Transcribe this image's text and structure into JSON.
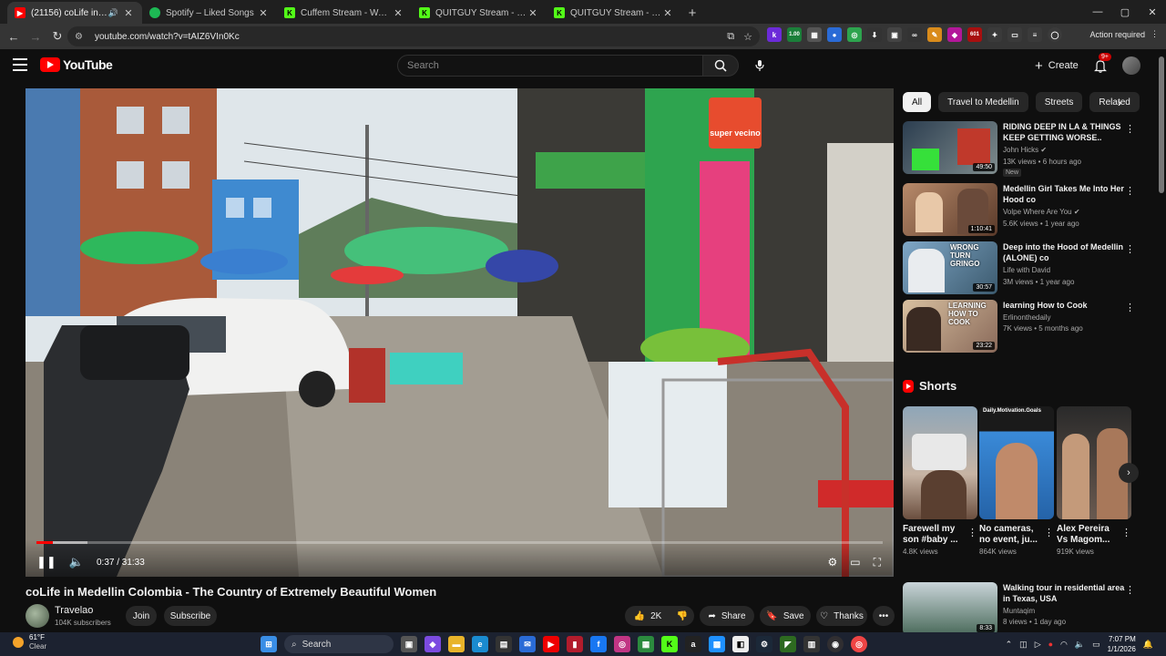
{
  "browser": {
    "tabs": [
      {
        "label": "(21156) coLife in Medellin C",
        "favicon_color": "#ff0000",
        "favicon_glyph": "▶",
        "active": true
      },
      {
        "label": "Spotify – Liked Songs",
        "favicon_color": "#1db954",
        "favicon_glyph": "◉",
        "active": false
      },
      {
        "label": "Cuffem Stream - Watch Live or",
        "favicon_color": "#53fc18",
        "favicon_glyph": "K",
        "active": false
      },
      {
        "label": "QUITGUY Stream - Watch Live",
        "favicon_color": "#53fc18",
        "favicon_glyph": "K",
        "active": false
      },
      {
        "label": "QUITGUY Stream - Kick Dashbo",
        "favicon_color": "#53fc18",
        "favicon_glyph": "K",
        "active": false
      }
    ],
    "new_tab": "+",
    "window_controls": {
      "minimize": "—",
      "maximize": "▢",
      "close": "✕"
    },
    "url": "youtube.com/watch?v=tAIZ6VIn0Kc",
    "action_required": "Action required",
    "extension_badge": "1.00",
    "extension_badge2": "601"
  },
  "youtube": {
    "logo_text": "YouTube",
    "search_placeholder": "Search",
    "create_label": "Create",
    "notif_badge": "9+"
  },
  "player": {
    "time": "0:37 / 31:33",
    "progress_fraction": 0.0196,
    "buffer_fraction": 0.06,
    "shop_sign": "super vecino"
  },
  "video": {
    "title": "coLife in Medellin Colombia - The Country of Extremely Beautiful Women",
    "channel": "Travelao",
    "subscribers": "104K subscribers",
    "join": "Join",
    "subscribe": "Subscribe",
    "likes": "2K",
    "share": "Share",
    "save": "Save",
    "thanks": "Thanks",
    "more": "•••"
  },
  "chips": [
    "All",
    "Travel to Medellin",
    "Streets",
    "Related"
  ],
  "recommendations": [
    {
      "title": "RIDING DEEP IN LA & THINGS KEEP GETTING WORSE..",
      "channel": "John Hicks",
      "meta": "13K views • 6 hours ago",
      "badge": "New",
      "duration": "49:50",
      "verified": true
    },
    {
      "title": "Medellin Girl Takes Me Into Her Hood co",
      "channel": "Volpe Where Are You",
      "meta": "5.6K views • 1 year ago",
      "badge": "",
      "duration": "1:10:41",
      "verified": true
    },
    {
      "title": "Deep into the Hood of Medellin (ALONE) co",
      "channel": "Life with David",
      "meta": "3M views • 1 year ago",
      "badge": "",
      "duration": "30:57",
      "verified": false,
      "thumb_text": "WRONG TURN GRINGO"
    },
    {
      "title": "learning How to Cook",
      "channel": "Erlinonthedaily",
      "meta": "7K views • 5 months ago",
      "badge": "",
      "duration": "23:22",
      "verified": false,
      "thumb_text": "LEARNING HOW TO COOK"
    }
  ],
  "shorts": {
    "heading": "Shorts",
    "items": [
      {
        "title": "Farewell my son #baby ...",
        "views": "4.8K views"
      },
      {
        "title": "No cameras, no event, ju...",
        "views": "864K views",
        "overlay": "Daily.Motivation.Goals"
      },
      {
        "title": "Alex Pereira Vs Magom...",
        "views": "919K views"
      }
    ]
  },
  "next_rec": {
    "title": "Walking tour in residential area in Texas, USA",
    "channel": "Muntaqim",
    "meta": "8 views • 1 day ago",
    "duration": "8:33"
  },
  "taskbar": {
    "temp": "61°F",
    "condition": "Clear",
    "search": "Search",
    "time": "7:07 PM",
    "date": "1/1/2026"
  }
}
